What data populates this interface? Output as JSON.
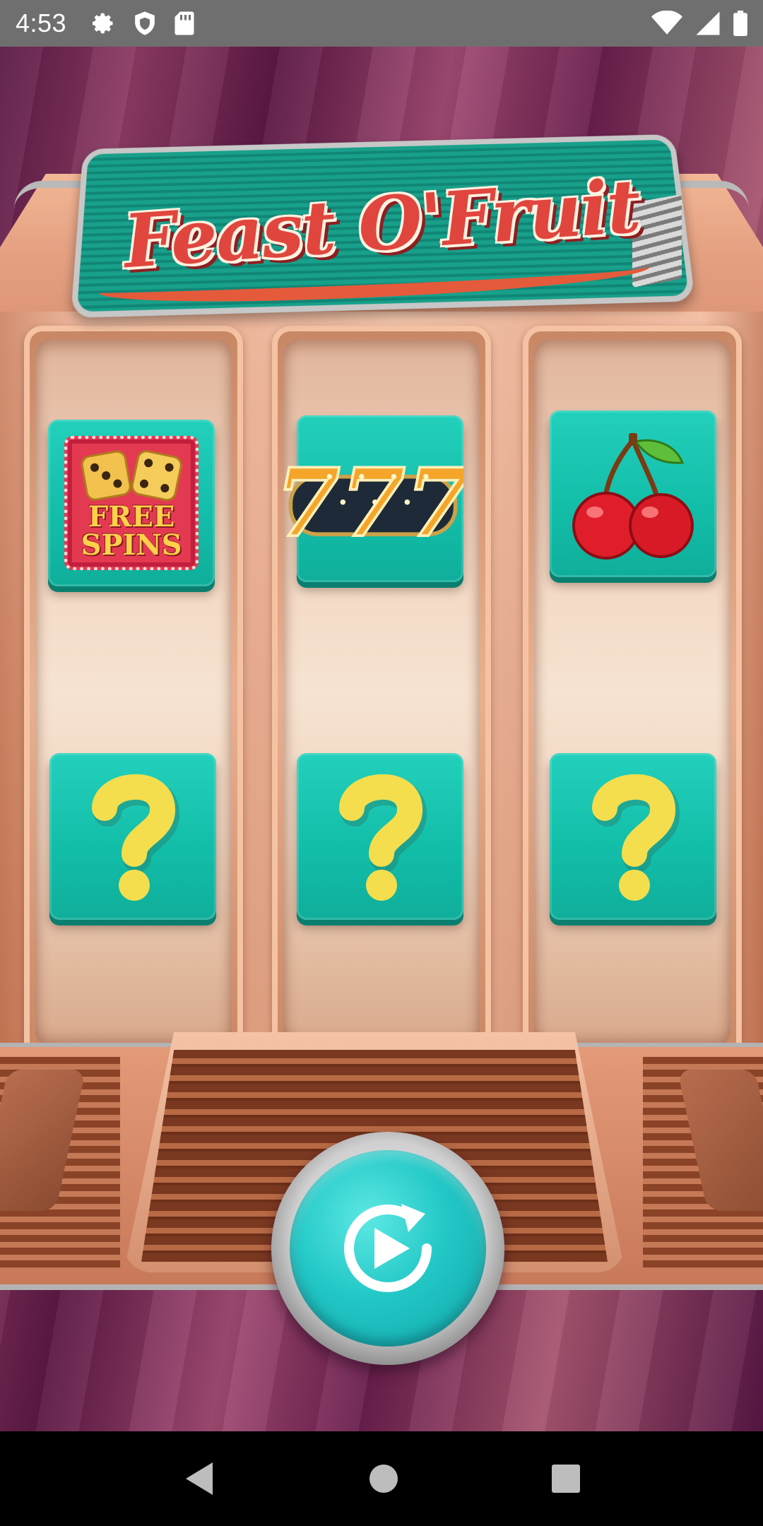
{
  "status_bar": {
    "time": "4:53",
    "left_icons": [
      "gear-icon",
      "shield-icon",
      "sd-card-icon"
    ],
    "right_icons": [
      "wifi-icon",
      "signal-icon",
      "battery-icon"
    ]
  },
  "game": {
    "logo_text": "Feast O'Fruit",
    "reels": [
      {
        "top_symbol": "free-spins",
        "top_symbol_text": "FREE SPINS",
        "bottom_symbol": "question-mark"
      },
      {
        "top_symbol": "triple-seven",
        "top_symbol_text": "777",
        "bottom_symbol": "question-mark"
      },
      {
        "top_symbol": "cherries",
        "top_symbol_text": "",
        "bottom_symbol": "question-mark"
      }
    ],
    "spin_button_icon": "replay-play-icon"
  },
  "nav_bar": {
    "buttons": [
      "back-icon",
      "home-icon",
      "recents-icon"
    ]
  },
  "colors": {
    "tile": "#16c2ad",
    "background": "#6a1f4d",
    "machine": "#e8a787",
    "spin": "#22c8c6"
  }
}
